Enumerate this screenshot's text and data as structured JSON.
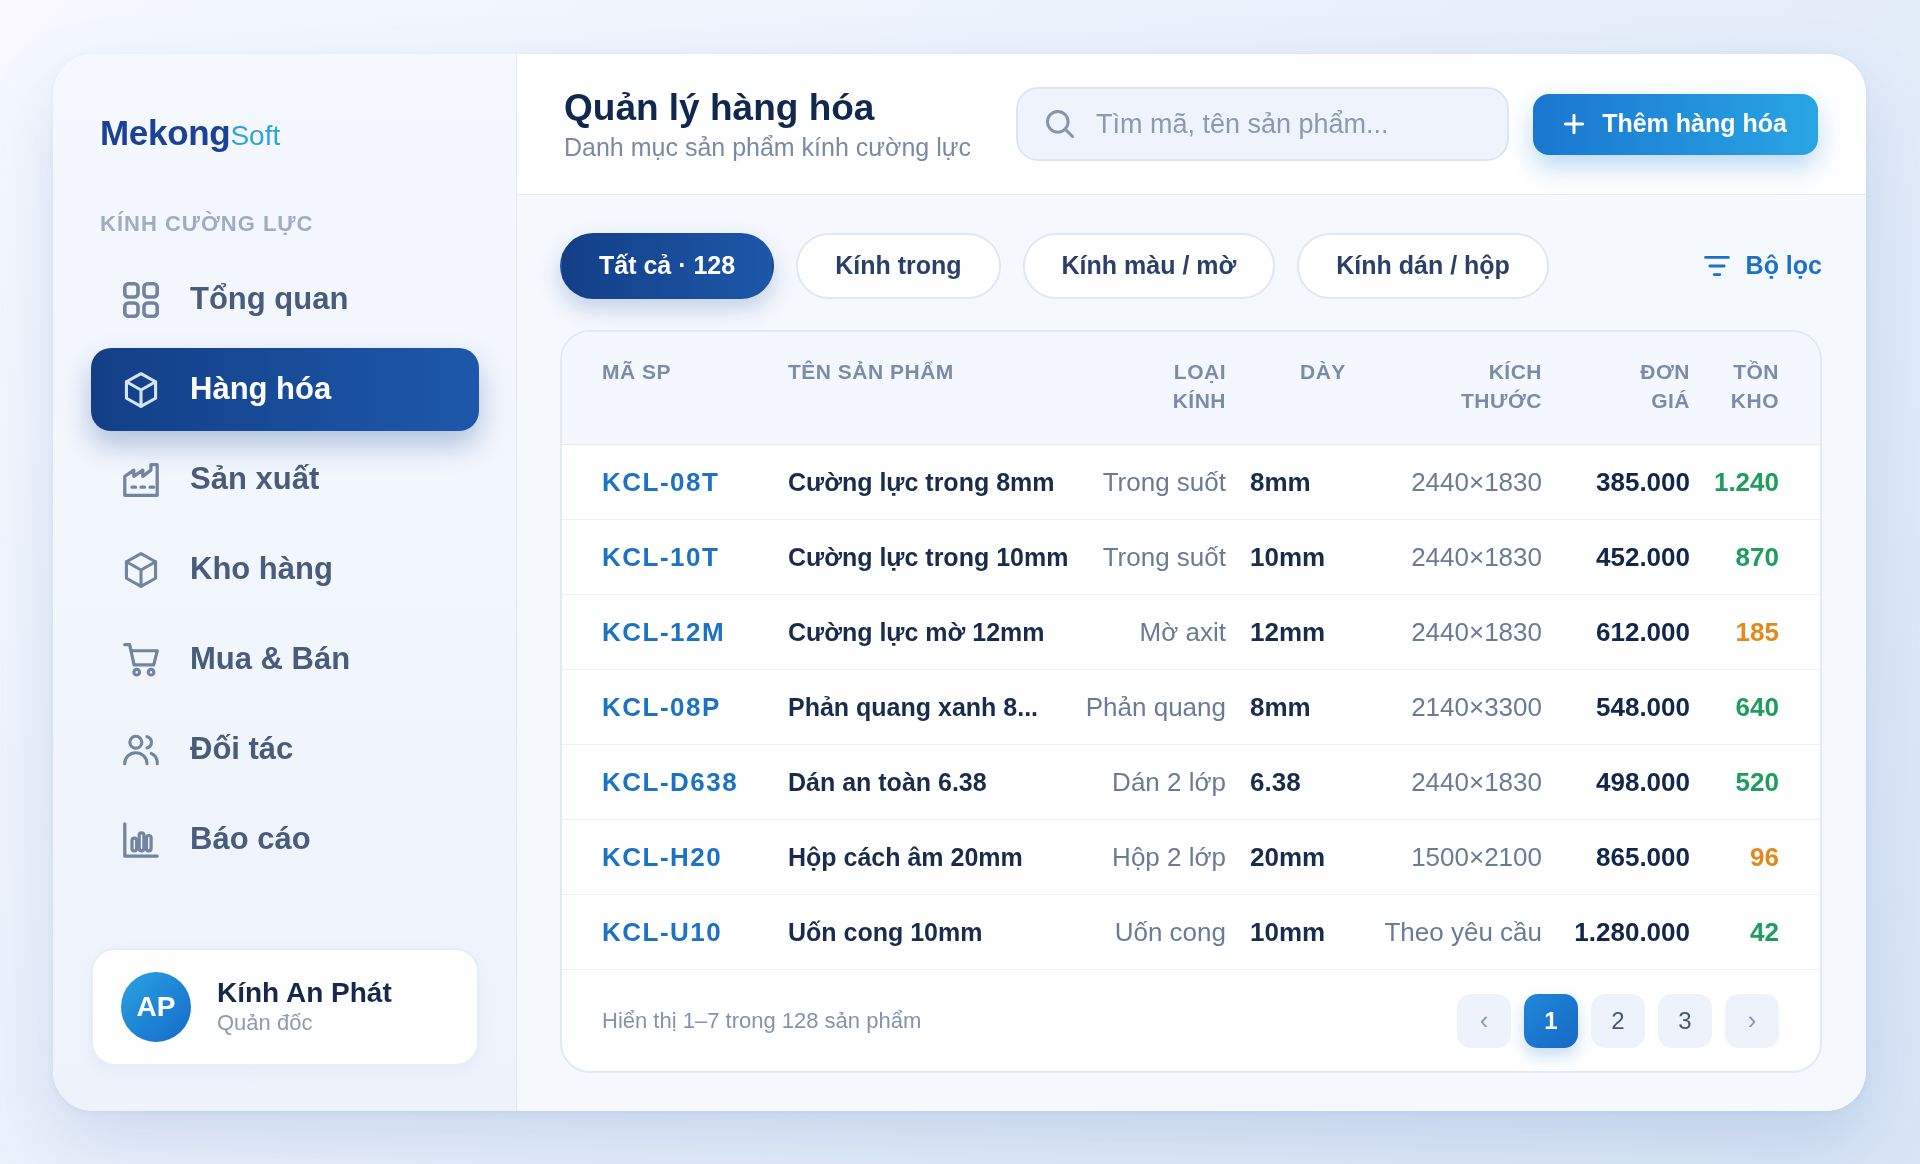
{
  "logo": {
    "name": "Mekong",
    "suffix": "Soft"
  },
  "sidebar": {
    "section_title": "KÍNH CƯỜNG LỰC",
    "items": [
      {
        "label": "Tổng quan",
        "selected": false
      },
      {
        "label": "Hàng hóa",
        "selected": true
      },
      {
        "label": "Sản xuất",
        "selected": false
      },
      {
        "label": "Kho hàng",
        "selected": false
      },
      {
        "label": "Mua & Bán",
        "selected": false
      },
      {
        "label": "Đối tác",
        "selected": false
      },
      {
        "label": "Báo cáo",
        "selected": false
      }
    ],
    "user": {
      "initials": "AP",
      "name": "Kính An Phát",
      "role": "Quản đốc"
    }
  },
  "header": {
    "title": "Quản lý hàng hóa",
    "subtitle": "Danh mục sản phẩm kính cường lực",
    "search": {
      "placeholder": "Tìm mã, tên sản phẩm..."
    },
    "add_button": "Thêm hàng hóa"
  },
  "tabs": [
    {
      "label": "Tất cả · 128",
      "selected": true
    },
    {
      "label": "Kính trong",
      "selected": false
    },
    {
      "label": "Kính màu / mờ",
      "selected": false
    },
    {
      "label": "Kính dán / hộp",
      "selected": false
    }
  ],
  "filter_button": "Bộ lọc",
  "table": {
    "columns": [
      "MÃ SP",
      "TÊN SẢN PHẨM",
      "LOẠI KÍNH",
      "DÀY",
      "KÍCH THƯỚC",
      "ĐƠN GIÁ",
      "TỒN KHO"
    ],
    "rows": [
      {
        "code": "KCL-08T",
        "name": "Cường lực trong 8mm",
        "glass_type": "Trong suốt",
        "thickness": "8mm",
        "size": "2440×1830",
        "price": "385.000",
        "stock": "1.240",
        "low_stock": false
      },
      {
        "code": "KCL-10T",
        "name": "Cường lực trong 10mm",
        "glass_type": "Trong suốt",
        "thickness": "10mm",
        "size": "2440×1830",
        "price": "452.000",
        "stock": "870",
        "low_stock": false
      },
      {
        "code": "KCL-12M",
        "name": "Cường lực mờ 12mm",
        "glass_type": "Mờ axit",
        "thickness": "12mm",
        "size": "2440×1830",
        "price": "612.000",
        "stock": "185",
        "low_stock": true
      },
      {
        "code": "KCL-08P",
        "name": "Phản quang xanh 8...",
        "glass_type": "Phản quang",
        "thickness": "8mm",
        "size": "2140×3300",
        "price": "548.000",
        "stock": "640",
        "low_stock": false
      },
      {
        "code": "KCL-D638",
        "name": "Dán an toàn 6.38",
        "glass_type": "Dán 2 lớp",
        "thickness": "6.38",
        "size": "2440×1830",
        "price": "498.000",
        "stock": "520",
        "low_stock": false
      },
      {
        "code": "KCL-H20",
        "name": "Hộp cách âm 20mm",
        "glass_type": "Hộp 2 lớp",
        "thickness": "20mm",
        "size": "1500×2100",
        "price": "865.000",
        "stock": "96",
        "low_stock": true
      },
      {
        "code": "KCL-U10",
        "name": "Uốn cong 10mm",
        "glass_type": "Uốn cong",
        "thickness": "10mm",
        "size": "Theo yêu cầu",
        "price": "1.280.000",
        "stock": "42",
        "low_stock": false
      }
    ]
  },
  "pagination": {
    "summary": "Hiển thị 1–7 trong 128 sản phẩm",
    "previous": "‹",
    "pages": [
      {
        "label": "1",
        "selected": true
      },
      {
        "label": "2",
        "selected": false
      },
      {
        "label": "3",
        "selected": false
      }
    ],
    "next": "›"
  }
}
